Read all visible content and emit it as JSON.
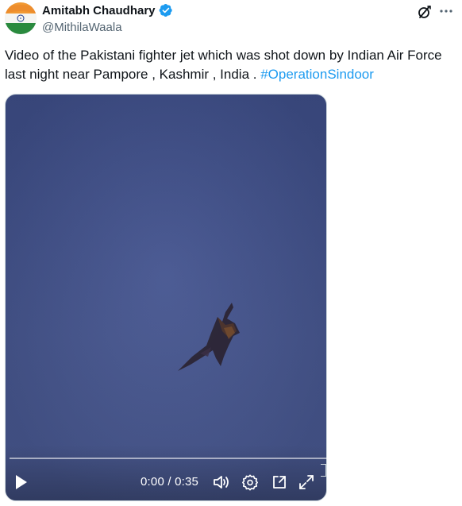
{
  "author": {
    "display_name": "Amitabh Chaudhary",
    "handle": "@MithilaWaala",
    "verified": true,
    "avatar": "indian-flag-avatar"
  },
  "tweet": {
    "text": "Video of the Pakistani fighter jet which was shot down by Indian Air Force last night near Pampore , Kashmir , India . ",
    "hashtag": "#OperationSindoor"
  },
  "video": {
    "current_time": "0:00",
    "separator": " / ",
    "duration": "0:35",
    "progress_fraction": 0,
    "content": "fighter-jet-in-sky"
  },
  "icons": {
    "grok": "grok-icon",
    "more": "more-icon",
    "play": "play-icon",
    "volume": "volume-icon",
    "settings": "settings-gear-icon",
    "pip": "picture-in-picture-icon",
    "fullscreen": "fullscreen-icon"
  },
  "colors": {
    "accent": "#1d9bf0",
    "text": "#0f1419",
    "secondary": "#536471",
    "verified": "#1d9bf0"
  }
}
